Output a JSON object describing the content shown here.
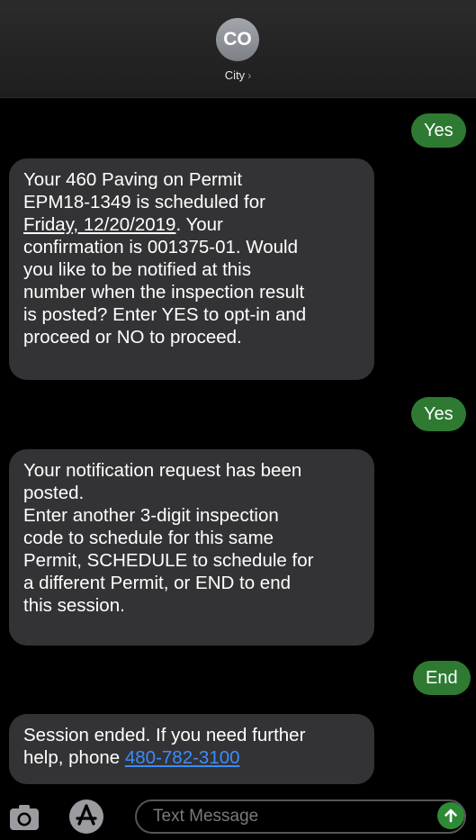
{
  "contact": {
    "initials": "CO",
    "name": "City",
    "chevron": "›"
  },
  "messages": [
    {
      "direction": "outgoing",
      "text": "Yes"
    },
    {
      "direction": "incoming",
      "lines": [
        "Your 460 Paving on Permit",
        "EPM18-1349 is scheduled for",
        "Friday, 12/20/2019",
        ". Your",
        "confirmation is 001375-01. Would",
        "you like to be notified at this",
        "number when the inspection result",
        "is posted? Enter YES to opt-in and",
        "proceed or NO to proceed."
      ]
    },
    {
      "direction": "outgoing",
      "text": "Yes"
    },
    {
      "direction": "incoming",
      "lines": [
        "Your notification request has been",
        "posted.",
        "Enter another 3-digit inspection",
        "code to schedule for this same",
        "Permit, SCHEDULE to schedule for",
        "a different Permit, or END to end",
        "this session."
      ]
    },
    {
      "direction": "outgoing",
      "text": "End"
    },
    {
      "direction": "incoming",
      "lines": [
        "Session ended. If you need further",
        "help, phone ",
        "480-782-3100"
      ]
    }
  ],
  "composer": {
    "placeholder": "Text Message",
    "camera_icon": "camera-icon",
    "apps_icon": "app-store-icon",
    "send_icon": "arrow-up-icon"
  },
  "colors": {
    "outgoing_bubble": "#2e7a33",
    "incoming_bubble": "#333335",
    "link": "#3b8cff",
    "send_button": "#2e8a35"
  }
}
